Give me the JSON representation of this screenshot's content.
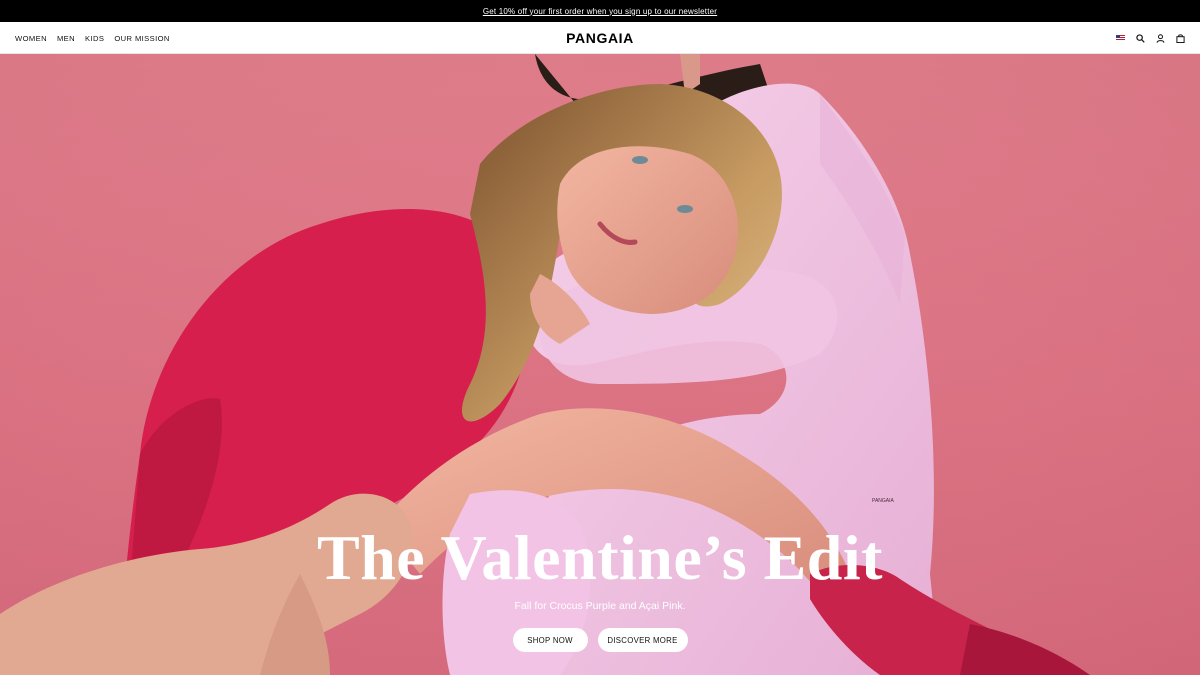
{
  "announcement": {
    "text": "Get 10% off your first order when you sign up to our newsletter"
  },
  "header": {
    "nav": [
      {
        "label": "WOMEN"
      },
      {
        "label": "MEN"
      },
      {
        "label": "KIDS"
      },
      {
        "label": "OUR MISSION"
      }
    ],
    "logo": "PANGAIA",
    "icons": [
      "us-flag-icon",
      "search-icon",
      "account-icon",
      "bag-icon"
    ]
  },
  "hero": {
    "title": "The Valentine’s Edit",
    "subtitle": "Fall for Crocus Purple and Açai Pink.",
    "buttons": {
      "shop": "SHOP NOW",
      "discover": "DISCOVER MORE"
    },
    "hoodie_print": "PANGAIA",
    "colors": {
      "background": "#dd7585",
      "hoodie": "#f2c3e4",
      "bodysuit": "#d61f4c",
      "sock": "#c8234a"
    }
  }
}
